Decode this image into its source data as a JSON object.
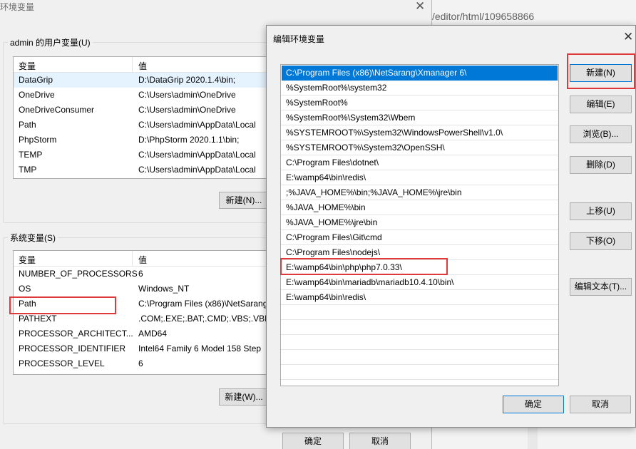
{
  "browser": {
    "url_fragment": "/editor/html/109658866"
  },
  "env_dialog": {
    "title": "环境变量",
    "close_glyph": "✕",
    "user_group": {
      "label": "admin 的用户变量(U)",
      "headers": {
        "name": "变量",
        "value": "值"
      },
      "rows": [
        {
          "name": "DataGrip",
          "value": "D:\\DataGrip 2020.1.4\\bin;"
        },
        {
          "name": "OneDrive",
          "value": "C:\\Users\\admin\\OneDrive"
        },
        {
          "name": "OneDriveConsumer",
          "value": "C:\\Users\\admin\\OneDrive"
        },
        {
          "name": "Path",
          "value": "C:\\Users\\admin\\AppData\\Local"
        },
        {
          "name": "PhpStorm",
          "value": "D:\\PhpStorm 2020.1.1\\bin;"
        },
        {
          "name": "TEMP",
          "value": "C:\\Users\\admin\\AppData\\Local"
        },
        {
          "name": "TMP",
          "value": "C:\\Users\\admin\\AppData\\Local"
        }
      ],
      "new_button": "新建(N)..."
    },
    "system_group": {
      "label": "系统变量(S)",
      "headers": {
        "name": "变量",
        "value": "值"
      },
      "rows": [
        {
          "name": "NUMBER_OF_PROCESSORS",
          "value": "6"
        },
        {
          "name": "OS",
          "value": "Windows_NT"
        },
        {
          "name": "Path",
          "value": "C:\\Program Files (x86)\\NetSarang"
        },
        {
          "name": "PATHEXT",
          "value": ".COM;.EXE;.BAT;.CMD;.VBS;.VBE"
        },
        {
          "name": "PROCESSOR_ARCHITECT...",
          "value": "AMD64"
        },
        {
          "name": "PROCESSOR_IDENTIFIER",
          "value": "Intel64 Family 6 Model 158 Step"
        },
        {
          "name": "PROCESSOR_LEVEL",
          "value": "6"
        }
      ],
      "new_button": "新建(W)..."
    },
    "ok_button": "确定",
    "cancel_button": "取消"
  },
  "edit_dialog": {
    "title": "编辑环境变量",
    "close_glyph": "✕",
    "paths": [
      "C:\\Program Files (x86)\\NetSarang\\Xmanager 6\\",
      "%SystemRoot%\\system32",
      "%SystemRoot%",
      "%SystemRoot%\\System32\\Wbem",
      "%SYSTEMROOT%\\System32\\WindowsPowerShell\\v1.0\\",
      "%SYSTEMROOT%\\System32\\OpenSSH\\",
      "C:\\Program Files\\dotnet\\",
      "E:\\wamp64\\bin\\redis\\",
      ";%JAVA_HOME%\\bin;%JAVA_HOME%\\jre\\bin",
      "%JAVA_HOME%\\bin",
      "%JAVA_HOME%\\jre\\bin",
      "C:\\Program Files\\Git\\cmd",
      "C:\\Program Files\\nodejs\\",
      "E:\\wamp64\\bin\\php\\php7.0.33\\",
      "E:\\wamp64\\bin\\mariadb\\mariadb10.4.10\\bin\\",
      "E:\\wamp64\\bin\\redis\\"
    ],
    "buttons": {
      "new": "新建(N)",
      "edit": "编辑(E)",
      "browse": "浏览(B)...",
      "delete": "删除(D)",
      "move_up": "上移(U)",
      "move_down": "下移(O)",
      "edit_text": "编辑文本(T)...",
      "ok": "确定",
      "cancel": "取消"
    }
  },
  "highlight_color": "#e0393c",
  "selection_color": "#0078d7"
}
